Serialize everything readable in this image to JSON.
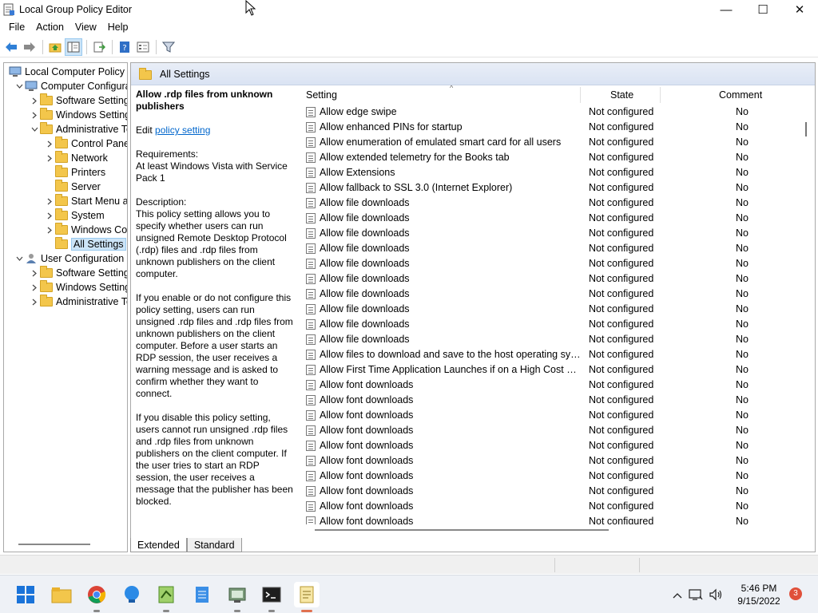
{
  "window": {
    "title": "Local Group Policy Editor",
    "controls": {
      "minimize": "—",
      "maximize": "☐",
      "close": "✕"
    }
  },
  "menu": [
    "File",
    "Action",
    "Help"
  ],
  "menu_view": "View",
  "toolbar": {
    "icons": [
      "back-arrow-icon",
      "forward-arrow-icon",
      "up-folder-icon",
      "show-hide-tree-icon",
      "export-list-icon",
      "help-icon",
      "properties-icon",
      "filter-icon"
    ]
  },
  "tree": {
    "items": [
      {
        "label": "Local Computer Policy",
        "level": 0,
        "expander": "",
        "icon": "computer-icon"
      },
      {
        "label": "Computer Configura",
        "level": 1,
        "expander": "v",
        "icon": "computer-icon"
      },
      {
        "label": "Software Settings",
        "level": 2,
        "expander": ">",
        "icon": "folder-icon"
      },
      {
        "label": "Windows Setting",
        "level": 2,
        "expander": ">",
        "icon": "folder-icon"
      },
      {
        "label": "Administrative Te",
        "level": 2,
        "expander": "v",
        "icon": "folder-icon"
      },
      {
        "label": "Control Panel",
        "level": 3,
        "expander": ">",
        "icon": "folder-icon"
      },
      {
        "label": "Network",
        "level": 3,
        "expander": ">",
        "icon": "folder-icon"
      },
      {
        "label": "Printers",
        "level": 3,
        "expander": "",
        "icon": "folder-icon"
      },
      {
        "label": "Server",
        "level": 3,
        "expander": "",
        "icon": "folder-icon"
      },
      {
        "label": "Start Menu ar",
        "level": 3,
        "expander": ">",
        "icon": "folder-icon"
      },
      {
        "label": "System",
        "level": 3,
        "expander": ">",
        "icon": "folder-icon"
      },
      {
        "label": "Windows Cor",
        "level": 3,
        "expander": ">",
        "icon": "folder-icon"
      },
      {
        "label": "All Settings",
        "level": 3,
        "expander": "",
        "icon": "folder-icon",
        "selected": true
      },
      {
        "label": "User Configuration",
        "level": 1,
        "expander": "v",
        "icon": "user-icon"
      },
      {
        "label": "Software Settings",
        "level": 2,
        "expander": ">",
        "icon": "folder-icon"
      },
      {
        "label": "Windows Setting",
        "level": 2,
        "expander": ">",
        "icon": "folder-icon"
      },
      {
        "label": "Administrative Te",
        "level": 2,
        "expander": ">",
        "icon": "folder-icon"
      }
    ]
  },
  "right": {
    "header": "All Settings",
    "description": {
      "title": "Allow .rdp files from unknown publishers",
      "edit_prefix": "Edit ",
      "edit_link": "policy setting",
      "requirements_label": "Requirements:",
      "requirements": "At least Windows Vista with Service Pack 1",
      "description_label": "Description:",
      "para1": "This policy setting allows you to specify whether users can run unsigned Remote Desktop Protocol (.rdp) files and .rdp files from unknown publishers on the client computer.",
      "para2": "If you enable or do not configure this policy setting, users can run unsigned .rdp files and .rdp files from unknown publishers on the client computer. Before a user starts an RDP session, the user receives a warning message and is asked to confirm whether they want to connect.",
      "para3": "If you disable this policy setting, users cannot run unsigned .rdp files and .rdp files from unknown publishers on the client computer. If the user tries to start an RDP session, the user receives a message that the publisher has been blocked."
    },
    "columns": {
      "setting": "Setting",
      "state": "State",
      "comment": "Comment"
    },
    "rows": [
      {
        "setting": "Allow edge swipe",
        "state": "Not configured",
        "comment": "No"
      },
      {
        "setting": "Allow enhanced PINs for startup",
        "state": "Not configured",
        "comment": "No"
      },
      {
        "setting": "Allow enumeration of emulated smart card for all users",
        "state": "Not configured",
        "comment": "No"
      },
      {
        "setting": "Allow extended telemetry for the Books tab",
        "state": "Not configured",
        "comment": "No"
      },
      {
        "setting": "Allow Extensions",
        "state": "Not configured",
        "comment": "No"
      },
      {
        "setting": "Allow fallback to SSL 3.0 (Internet Explorer)",
        "state": "Not configured",
        "comment": "No"
      },
      {
        "setting": "Allow file downloads",
        "state": "Not configured",
        "comment": "No"
      },
      {
        "setting": "Allow file downloads",
        "state": "Not configured",
        "comment": "No"
      },
      {
        "setting": "Allow file downloads",
        "state": "Not configured",
        "comment": "No"
      },
      {
        "setting": "Allow file downloads",
        "state": "Not configured",
        "comment": "No"
      },
      {
        "setting": "Allow file downloads",
        "state": "Not configured",
        "comment": "No"
      },
      {
        "setting": "Allow file downloads",
        "state": "Not configured",
        "comment": "No"
      },
      {
        "setting": "Allow file downloads",
        "state": "Not configured",
        "comment": "No"
      },
      {
        "setting": "Allow file downloads",
        "state": "Not configured",
        "comment": "No"
      },
      {
        "setting": "Allow file downloads",
        "state": "Not configured",
        "comment": "No"
      },
      {
        "setting": "Allow file downloads",
        "state": "Not configured",
        "comment": "No"
      },
      {
        "setting": "Allow files to download and save to the host operating syste...",
        "state": "Not configured",
        "comment": "No"
      },
      {
        "setting": "Allow First Time Application Launches if on a High Cost Win...",
        "state": "Not configured",
        "comment": "No"
      },
      {
        "setting": "Allow font downloads",
        "state": "Not configured",
        "comment": "No"
      },
      {
        "setting": "Allow font downloads",
        "state": "Not configured",
        "comment": "No"
      },
      {
        "setting": "Allow font downloads",
        "state": "Not configured",
        "comment": "No"
      },
      {
        "setting": "Allow font downloads",
        "state": "Not configured",
        "comment": "No"
      },
      {
        "setting": "Allow font downloads",
        "state": "Not configured",
        "comment": "No"
      },
      {
        "setting": "Allow font downloads",
        "state": "Not configured",
        "comment": "No"
      },
      {
        "setting": "Allow font downloads",
        "state": "Not configured",
        "comment": "No"
      },
      {
        "setting": "Allow font downloads",
        "state": "Not configured",
        "comment": "No"
      },
      {
        "setting": "Allow font downloads",
        "state": "Not configured",
        "comment": "No"
      },
      {
        "setting": "Allow font downloads",
        "state": "Not configured",
        "comment": "No"
      }
    ]
  },
  "tabs": {
    "extended": "Extended",
    "standard": "Standard"
  },
  "taskbar": {
    "icons": [
      "start-icon",
      "file-explorer-icon",
      "chrome-icon",
      "tips-icon",
      "notepad-plus-icon",
      "notepad-icon",
      "mmc-icon",
      "terminal-icon",
      "group-policy-icon"
    ],
    "time": "5:46 PM",
    "date": "9/15/2022",
    "notifications": "3"
  },
  "colors": {
    "accent": "#0066cc",
    "header_band": "#dae3f3",
    "folder": "#f3c64b",
    "badge": "#e0503a"
  }
}
